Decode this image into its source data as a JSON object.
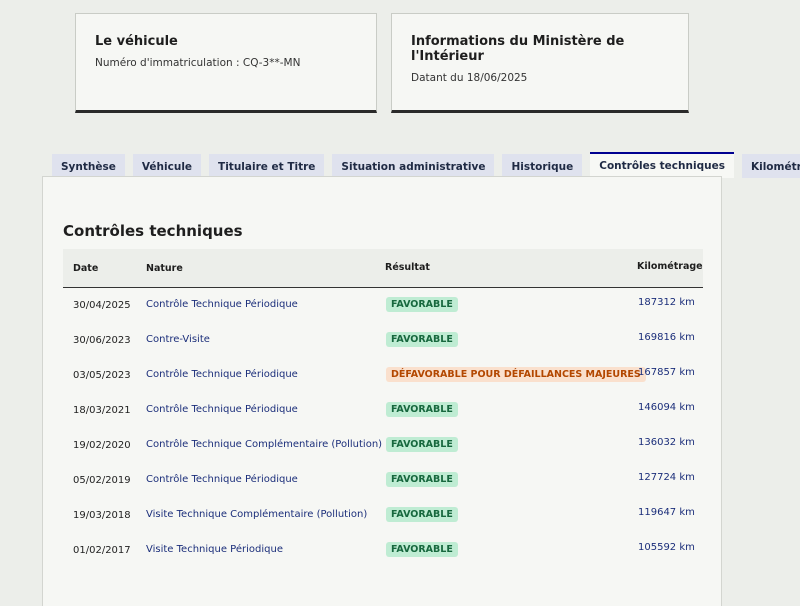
{
  "cards": {
    "vehicle": {
      "title": "Le véhicule",
      "subtitle": "Numéro d'immatriculation : CQ-3**-MN"
    },
    "ministry": {
      "title": "Informations du Ministère de l'Intérieur",
      "subtitle": "Datant du 18/06/2025"
    }
  },
  "tabs": [
    {
      "label": "Synthèse"
    },
    {
      "label": "Véhicule"
    },
    {
      "label": "Titulaire et Titre"
    },
    {
      "label": "Situation administrative"
    },
    {
      "label": "Historique"
    },
    {
      "label": "Contrôles techniques",
      "active": true
    },
    {
      "label": "Kilométrage"
    }
  ],
  "panel": {
    "title": "Contrôles techniques",
    "columns": {
      "date": "Date",
      "nature": "Nature",
      "result": "Résultat",
      "km": "Kilométrage"
    },
    "rows": [
      {
        "date": "30/04/2025",
        "nature": "Contrôle Technique Périodique",
        "result": "FAVORABLE",
        "status": "fav",
        "km": "187312 km"
      },
      {
        "date": "30/06/2023",
        "nature": "Contre-Visite",
        "result": "FAVORABLE",
        "status": "fav",
        "km": "169816 km"
      },
      {
        "date": "03/05/2023",
        "nature": "Contrôle Technique Périodique",
        "result": "DÉFAVORABLE POUR DÉFAILLANCES MAJEURES",
        "status": "defav",
        "km": "167857 km"
      },
      {
        "date": "18/03/2021",
        "nature": "Contrôle Technique Périodique",
        "result": "FAVORABLE",
        "status": "fav",
        "km": "146094 km"
      },
      {
        "date": "19/02/2020",
        "nature": "Contrôle Technique Complémentaire (Pollution)",
        "result": "FAVORABLE",
        "status": "fav",
        "km": "136032 km"
      },
      {
        "date": "05/02/2019",
        "nature": "Contrôle Technique Périodique",
        "result": "FAVORABLE",
        "status": "fav",
        "km": "127724 km"
      },
      {
        "date": "19/03/2018",
        "nature": "Visite Technique Complémentaire (Pollution)",
        "result": "FAVORABLE",
        "status": "fav",
        "km": "119647 km"
      },
      {
        "date": "01/02/2017",
        "nature": "Visite Technique Périodique",
        "result": "FAVORABLE",
        "status": "fav",
        "km": "105592 km"
      }
    ]
  },
  "colors": {
    "accent": "#000091",
    "favorable_bg": "#bfecd3",
    "favorable_text": "#17683e",
    "defavorable_bg": "#fae0cd",
    "defavorable_text": "#b34700"
  }
}
